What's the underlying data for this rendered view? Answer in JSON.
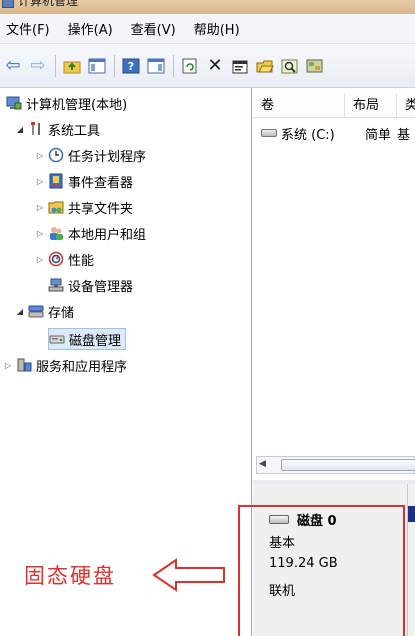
{
  "window": {
    "title": "计算机管理"
  },
  "menu": [
    "文件(F)",
    "操作(A)",
    "查看(V)",
    "帮助(H)"
  ],
  "toolbar": {
    "icons": [
      "back-arrow-icon",
      "forward-arrow-icon",
      "up-folder-icon",
      "show-hide-tree-icon",
      "help-icon",
      "show-hide-action-icon",
      "refresh-icon",
      "delete-icon",
      "properties-icon",
      "open-icon",
      "search-icon",
      "disk-settings-icon"
    ],
    "delete_glyph": "✕"
  },
  "tree": {
    "root": "计算机管理(本地)",
    "system_tools": "系统工具",
    "task_scheduler": "任务计划程序",
    "event_viewer": "事件查看器",
    "shared_folders": "共享文件夹",
    "local_users": "本地用户和组",
    "performance": "性能",
    "device_manager": "设备管理器",
    "storage": "存储",
    "disk_management": "磁盘管理",
    "services_apps": "服务和应用程序"
  },
  "volumes": {
    "columns": [
      "卷",
      "布局",
      "类"
    ],
    "rows": [
      {
        "name": "系统 (C:)",
        "layout": "简单",
        "type": "基"
      }
    ]
  },
  "disk": {
    "name": "磁盘 0",
    "type": "基本",
    "size": "119.24 GB",
    "status": "联机"
  },
  "annotation": {
    "label": "固态硬盘",
    "color": "#e0302b"
  }
}
